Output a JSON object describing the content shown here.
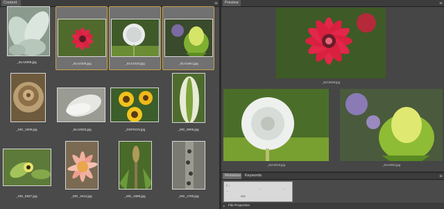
{
  "content_panel": {
    "tab": "Content",
    "menu_icon": "panel-menu-icon",
    "thumbnails": [
      {
        "filename": "_61A2089.jpg",
        "selected": false
      },
      {
        "filename": "_61A2328.jpg",
        "selected": true
      },
      {
        "filename": "_61A2410.jpg",
        "selected": true
      },
      {
        "filename": "_61A2461.jpg",
        "selected": true
      },
      {
        "filename": "_MG_1508.jpg",
        "selected": false
      },
      {
        "filename": "_61A2532.jpg",
        "selected": false
      },
      {
        "filename": "_DSF0219.jpg",
        "selected": false
      },
      {
        "filename": "_MG_0605.jpg",
        "selected": false
      },
      {
        "filename": "_MG_0937.jpg",
        "selected": false
      },
      {
        "filename": "_MG_1612.jpg",
        "selected": false
      },
      {
        "filename": "_MG_1688.jpg",
        "selected": false
      },
      {
        "filename": "_MG_1769.jpg",
        "selected": false
      }
    ]
  },
  "preview_panel": {
    "tab": "Preview",
    "menu_icon": "panel-menu-icon",
    "images": [
      {
        "filename": "_61A2328.jpg"
      },
      {
        "filename": "_61A2410.jpg"
      },
      {
        "filename": "_61A2461.jpg"
      }
    ]
  },
  "metadata_panel": {
    "tabs": [
      "Metadata",
      "Keywords"
    ],
    "file_properties_label": "File Properties",
    "menu_icon": "panel-menu-icon"
  },
  "colors": {
    "selection_border": "#c8a24c",
    "panel_bg": "#4a4a4a",
    "selected_cell": "#717171"
  }
}
